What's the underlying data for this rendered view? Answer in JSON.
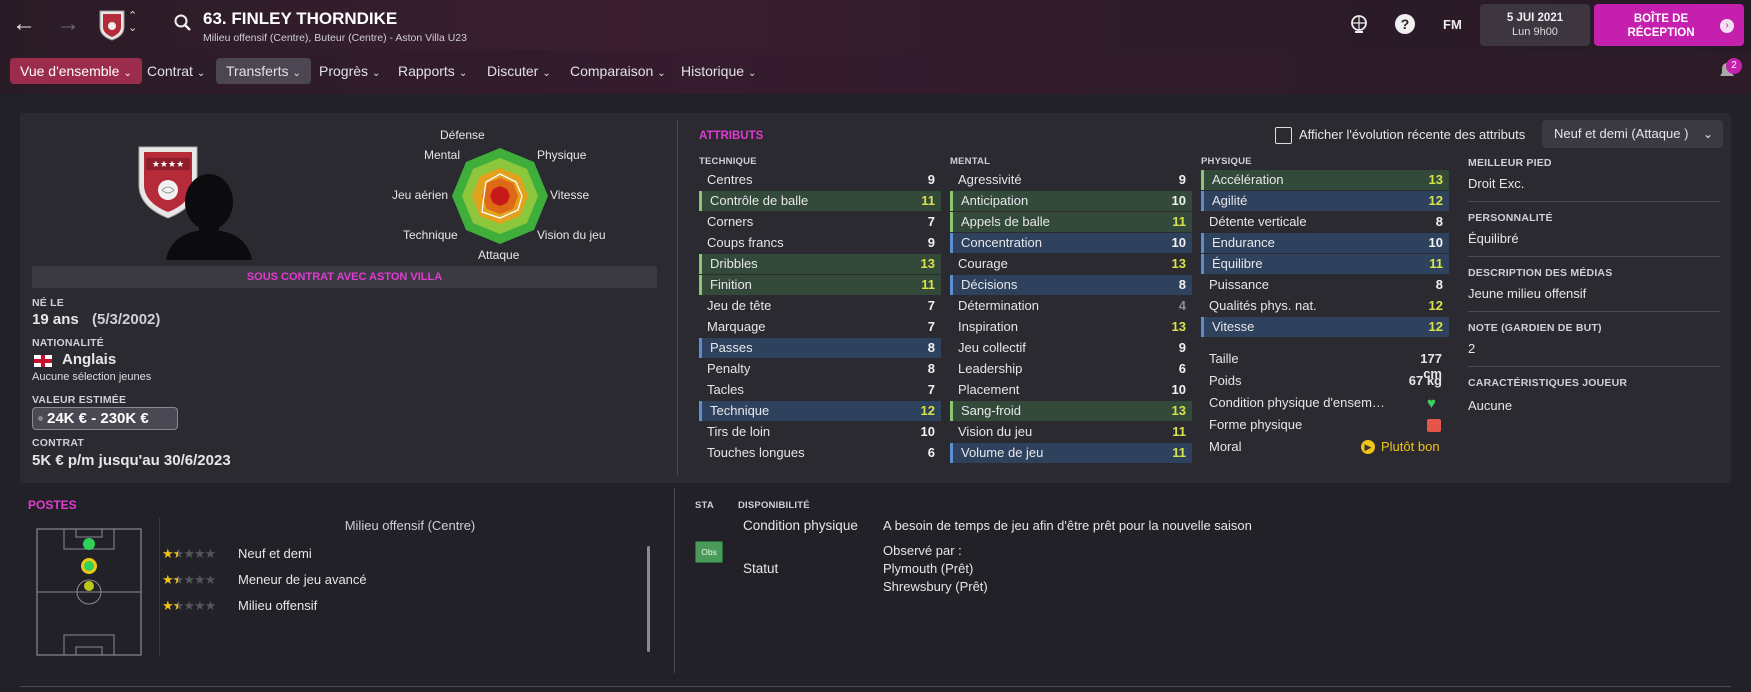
{
  "header": {
    "title": "63. FINLEY THORNDIKE",
    "subtitle": "Milieu offensif (Centre), Buteur (Centre) - Aston Villa U23",
    "fm": "FM",
    "date": "5 JUI 2021",
    "time": "Lun 9h00",
    "inbox": "BOÎTE DE RÉCEPTION",
    "notif_count": "2"
  },
  "menu": [
    "Vue d'ensemble",
    "Contrat",
    "Transferts",
    "Progrès",
    "Rapports",
    "Discuter",
    "Comparaison",
    "Historique"
  ],
  "radar": {
    "labels": {
      "top": "Défense",
      "tr": "Physique",
      "r": "Vitesse",
      "br": "Vision du jeu",
      "bottom": "Attaque",
      "bl": "Technique",
      "l": "Jeu aérien",
      "tl": "Mental"
    }
  },
  "contract_banner": "SOUS CONTRAT AVEC ASTON VILLA",
  "info": {
    "born_lbl": "NÉ LE",
    "age": "19 ans",
    "dob": "(5/3/2002)",
    "nat_lbl": "NATIONALITÉ",
    "nat": "Anglais",
    "caps": "Aucune sélection jeunes",
    "value_lbl": "VALEUR ESTIMÉE",
    "value": "24K € - 230K €",
    "contract_lbl": "CONTRAT",
    "contract": "5K € p/m jusqu'au 30/6/2023"
  },
  "attributes": {
    "title": "ATTRIBUTS",
    "toggle": "Afficher l'évolution récente des attributs",
    "role": "Neuf et demi (Attaque )",
    "technique_lbl": "TECHNIQUE",
    "mental_lbl": "MENTAL",
    "physique_lbl": "PHYSIQUE",
    "technique": [
      [
        "Centres",
        "9"
      ],
      [
        "Contrôle de balle",
        "11"
      ],
      [
        "Corners",
        "7"
      ],
      [
        "Coups francs",
        "9"
      ],
      [
        "Dribbles",
        "13"
      ],
      [
        "Finition",
        "11"
      ],
      [
        "Jeu de tête",
        "7"
      ],
      [
        "Marquage",
        "7"
      ],
      [
        "Passes",
        "8"
      ],
      [
        "Penalty",
        "8"
      ],
      [
        "Tacles",
        "7"
      ],
      [
        "Technique",
        "12"
      ],
      [
        "Tirs de loin",
        "10"
      ],
      [
        "Touches longues",
        "6"
      ]
    ],
    "mental": [
      [
        "Agressivité",
        "9"
      ],
      [
        "Anticipation",
        "10"
      ],
      [
        "Appels de balle",
        "11"
      ],
      [
        "Concentration",
        "10"
      ],
      [
        "Courage",
        "13"
      ],
      [
        "Décisions",
        "8"
      ],
      [
        "Détermination",
        "4"
      ],
      [
        "Inspiration",
        "13"
      ],
      [
        "Jeu collectif",
        "9"
      ],
      [
        "Leadership",
        "6"
      ],
      [
        "Placement",
        "10"
      ],
      [
        "Sang-froid",
        "13"
      ],
      [
        "Vision du jeu",
        "11"
      ],
      [
        "Volume de jeu",
        "11"
      ]
    ],
    "physique": [
      [
        "Accélération",
        "13"
      ],
      [
        "Agilité",
        "12"
      ],
      [
        "Détente verticale",
        "8"
      ],
      [
        "Endurance",
        "10"
      ],
      [
        "Équilibre",
        "11"
      ],
      [
        "Puissance",
        "8"
      ],
      [
        "Qualités phys. nat.",
        "12"
      ],
      [
        "Vitesse",
        "12"
      ]
    ],
    "body": {
      "taille_lbl": "Taille",
      "taille": "177 cm",
      "poids_lbl": "Poids",
      "poids": "67 kg",
      "cond_lbl": "Condition physique d'ensem…",
      "forme_lbl": "Forme physique",
      "moral_lbl": "Moral",
      "moral": "Plutôt bon"
    }
  },
  "side": {
    "pied_lbl": "MEILLEUR PIED",
    "pied": "Droit Exc.",
    "perso_lbl": "PERSONNALITÉ",
    "perso": "Équilibré",
    "media_lbl": "DESCRIPTION DES MÉDIAS",
    "media": "Jeune milieu offensif",
    "gk_lbl": "NOTE (GARDIEN DE BUT)",
    "gk": "2",
    "car_lbl": "CARACTÉRISTIQUES JOUEUR",
    "car": "Aucune"
  },
  "postes": {
    "title": "POSTES",
    "main": "Milieu offensif (Centre)",
    "roles": [
      {
        "name": "Neuf et demi",
        "stars": 1.5
      },
      {
        "name": "Meneur de jeu avancé",
        "stars": 1.5
      },
      {
        "name": "Milieu offensif",
        "stars": 1.5
      }
    ]
  },
  "dispo": {
    "sta": "STA",
    "title": "DISPONIBILITÉ",
    "cond_lbl": "Condition physique",
    "cond": "A besoin de temps de jeu afin d'être prêt pour la nouvelle saison",
    "badge": "Obs",
    "statut_lbl": "Statut",
    "obs": "Observé par :",
    "club1": "Plymouth (Prêt)",
    "club2": "Shrewsbury (Prêt)"
  },
  "colors": {
    "accent": "#e23ad2",
    "active_tab": "#9b2c4c",
    "green_row": "#334a3a",
    "blue_row": "#2f425d",
    "highlight": "#d8e24a"
  }
}
